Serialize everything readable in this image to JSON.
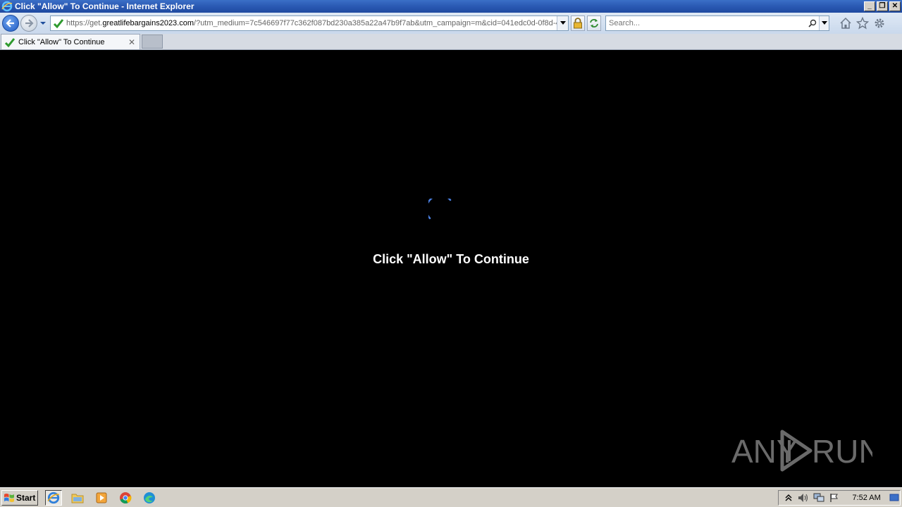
{
  "window": {
    "title": "Click \"Allow\" To Continue - Internet Explorer",
    "controls": {
      "minimize": "_",
      "restore": "❐",
      "close": "✕"
    }
  },
  "navbar": {
    "url_prefix": "https://get.",
    "url_domain": "greatlifebargains2023.com",
    "url_rest": "/?utm_medium=7c546697f77c362f087bd230a385a22a47b9f7ab&utm_campaign=m&cid=041edc0d-0f8d-4",
    "search_placeholder": "Search..."
  },
  "tabs": [
    {
      "label": "Click \"Allow\" To Continue",
      "close": "✕"
    }
  ],
  "page": {
    "message": "Click \"Allow\" To Continue",
    "spinner_color": "#4a7fe0"
  },
  "watermark": {
    "text_left": "ANY",
    "text_right": "RUN"
  },
  "taskbar": {
    "start_label": "Start",
    "clock": "7:52 AM"
  }
}
